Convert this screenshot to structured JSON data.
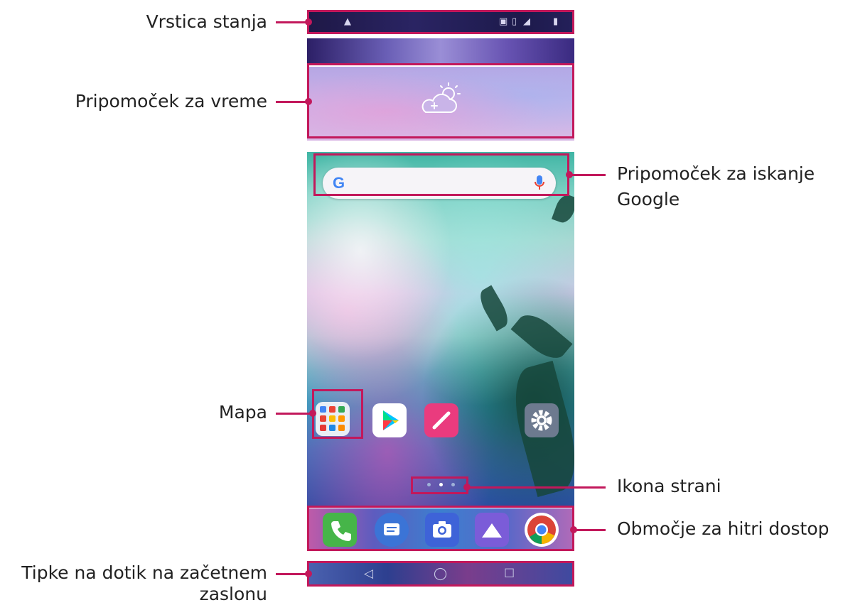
{
  "labels": {
    "status_bar": "Vrstica stanja",
    "weather_widget": "Pripomoček za vreme",
    "google_search_line1": "Pripomoček za iskanje",
    "google_search_line2": "Google",
    "folder": "Mapa",
    "page_icon": "Ikona strani",
    "quick_access": "Območje za hitri dostop",
    "home_touch_keys_line1": "Tipke na dotik na začetnem",
    "home_touch_keys_line2": "zaslonu"
  },
  "phone": {
    "search_logo": "G",
    "nav_keys": {
      "back": "◁",
      "home": "◯",
      "recents": "☐"
    }
  },
  "colors": {
    "annotation": "#c2185b",
    "label_text": "#222222"
  },
  "icons": {
    "weather": "cloud-sun-plus-icon",
    "mic": "microphone-icon",
    "folder": "app-folder-icon",
    "play": "play-store-icon",
    "pen": "note-pen-icon",
    "settings": "gear-icon",
    "dock": [
      "phone-icon",
      "messages-icon",
      "camera-icon",
      "gallery-icon",
      "chrome-icon"
    ]
  }
}
